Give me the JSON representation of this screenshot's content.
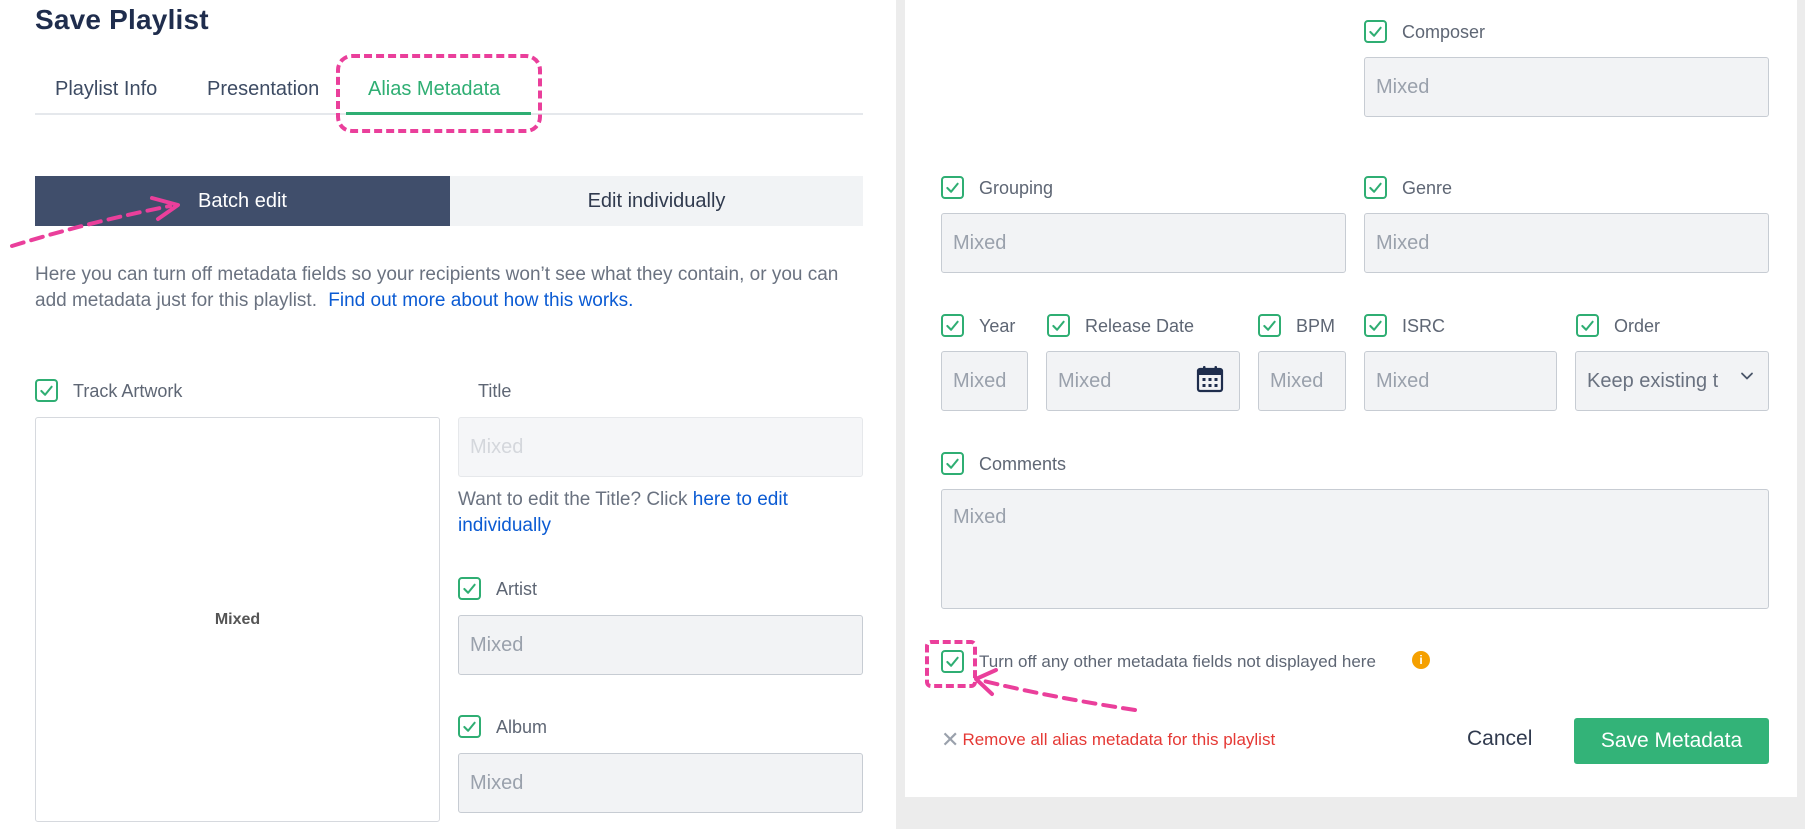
{
  "page_title": "Save Playlist",
  "tabs": [
    {
      "label": "Playlist Info"
    },
    {
      "label": "Presentation"
    },
    {
      "label": "Alias Metadata",
      "active": true
    }
  ],
  "segmented": {
    "batch_label": "Batch edit",
    "individual_label": "Edit individually",
    "selected": "Batch edit"
  },
  "intro": {
    "text": "Here you can turn off metadata fields so your recipients won’t see what they contain, or you can add metadata just for this playlist.",
    "link": "Find out more about how this works."
  },
  "fields": {
    "track_artwork": {
      "label": "Track Artwork",
      "checked": true,
      "value": "Mixed"
    },
    "title": {
      "label": "Title",
      "placeholder": "Mixed",
      "hint_text": "Want to edit the Title? Click",
      "hint_link": "here to edit individually"
    },
    "artist": {
      "label": "Artist",
      "checked": true,
      "placeholder": "Mixed"
    },
    "album": {
      "label": "Album",
      "checked": true,
      "placeholder": "Mixed"
    },
    "composer": {
      "label": "Composer",
      "checked": true,
      "placeholder": "Mixed"
    },
    "grouping": {
      "label": "Grouping",
      "checked": true,
      "placeholder": "Mixed"
    },
    "genre": {
      "label": "Genre",
      "checked": true,
      "placeholder": "Mixed"
    },
    "year": {
      "label": "Year",
      "checked": true,
      "placeholder": "Mixed"
    },
    "release_date": {
      "label": "Release Date",
      "checked": true,
      "placeholder": "Mixed"
    },
    "bpm": {
      "label": "BPM",
      "checked": true,
      "placeholder": "Mixed"
    },
    "isrc": {
      "label": "ISRC",
      "checked": true,
      "placeholder": "Mixed"
    },
    "order": {
      "label": "Order",
      "checked": true,
      "value": "Keep existing t"
    },
    "comments": {
      "label": "Comments",
      "checked": true,
      "placeholder": "Mixed"
    }
  },
  "turn_off_others": {
    "label": "Turn off any other metadata fields not displayed here",
    "checked": true,
    "info_glyph": "i"
  },
  "footer": {
    "remove_label": "Remove all alias metadata for this playlist",
    "remove_glyph": "✕",
    "cancel_label": "Cancel",
    "save_label": "Save Metadata"
  },
  "colors": {
    "accent": "#2fae73",
    "highlight": "#ea3f9b",
    "primary_dark": "#404e6b",
    "danger": "#e53935",
    "link": "#0b5bd3"
  }
}
